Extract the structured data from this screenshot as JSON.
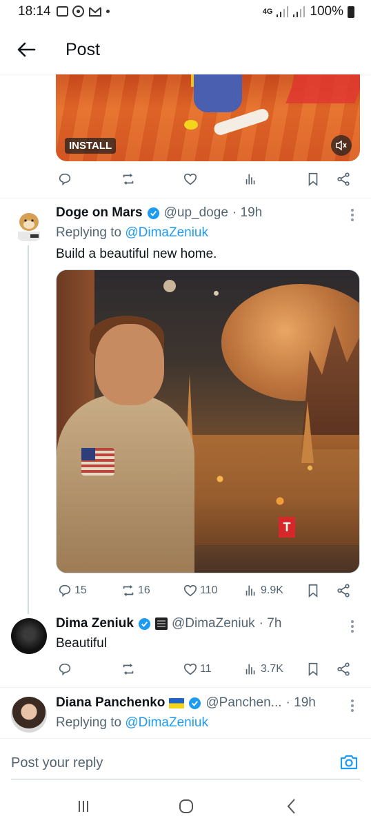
{
  "status_bar": {
    "time": "18:14",
    "network": "4G",
    "battery": "100%",
    "notification_icons": [
      "gallery-icon",
      "soccer-ball-icon",
      "gmail-icon",
      "dot-icon"
    ]
  },
  "header": {
    "title": "Post"
  },
  "ad_media": {
    "install_label": "INSTALL"
  },
  "tweets": [
    {
      "name": "Doge on Mars",
      "handle": "@up_doge",
      "time": "· 19h",
      "replying_prefix": "Replying to",
      "replying_to": "@DimaZeniuk",
      "text": "Build a beautiful new home.",
      "stats": {
        "replies": "15",
        "retweets": "16",
        "likes": "110",
        "views": "9.9K"
      }
    },
    {
      "name": "Dima Zeniuk",
      "handle": "@DimaZeniuk",
      "time": "· 7h",
      "text": "Beautiful",
      "stats": {
        "replies": "",
        "retweets": "",
        "likes": "11",
        "views": "3.7K"
      }
    },
    {
      "name": "Diana Panchenko",
      "flag": "🇺🇦",
      "handle": "@Panchen...",
      "time": "· 19h",
      "replying_prefix": "Replying to",
      "replying_to": "@DimaZeniuk"
    }
  ],
  "compose": {
    "placeholder": "Post your reply"
  },
  "colors": {
    "accent": "#1d9bf0",
    "text": "#0f1419",
    "secondary": "#536471",
    "divider": "#eff3f4"
  }
}
